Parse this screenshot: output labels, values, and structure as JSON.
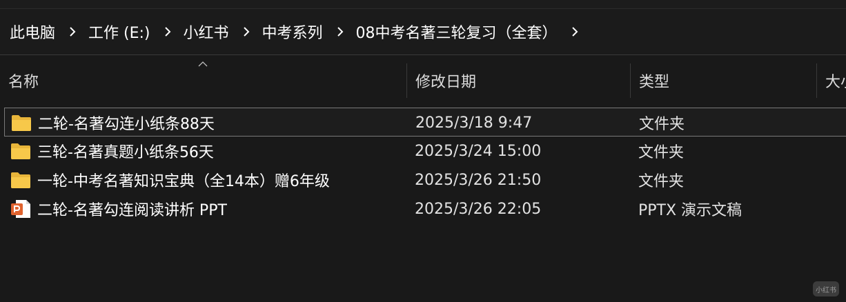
{
  "breadcrumb": {
    "items": [
      {
        "label": "此电脑"
      },
      {
        "label": "工作 (E:)"
      },
      {
        "label": "小红书"
      },
      {
        "label": "中考系列"
      },
      {
        "label": "08中考名著三轮复习（全套）"
      }
    ]
  },
  "columns": {
    "name": "名称",
    "date": "修改日期",
    "type": "类型",
    "size": "大小"
  },
  "files": [
    {
      "name": "二轮-名著勾连小纸条88天",
      "date": "2025/3/18 9:47",
      "type": "文件夹",
      "icon": "folder-icon",
      "selected": true
    },
    {
      "name": "三轮-名著真题小纸条56天",
      "date": "2025/3/24 15:00",
      "type": "文件夹",
      "icon": "folder-icon",
      "selected": false
    },
    {
      "name": "一轮-中考名著知识宝典（全14本）赠6年级",
      "date": "2025/3/26 21:50",
      "type": "文件夹",
      "icon": "folder-icon",
      "selected": false
    },
    {
      "name": "二轮-名著勾连阅读讲析  PPT",
      "date": "2025/3/26 22:05",
      "type": "PPTX 演示文稿",
      "icon": "powerpoint-icon",
      "selected": false
    }
  ],
  "watermark": "小红书",
  "colors": {
    "background": "#191919",
    "folder": "#f4c343",
    "powerpoint": "#e0632f",
    "selected_border": "#7a7a7a"
  }
}
